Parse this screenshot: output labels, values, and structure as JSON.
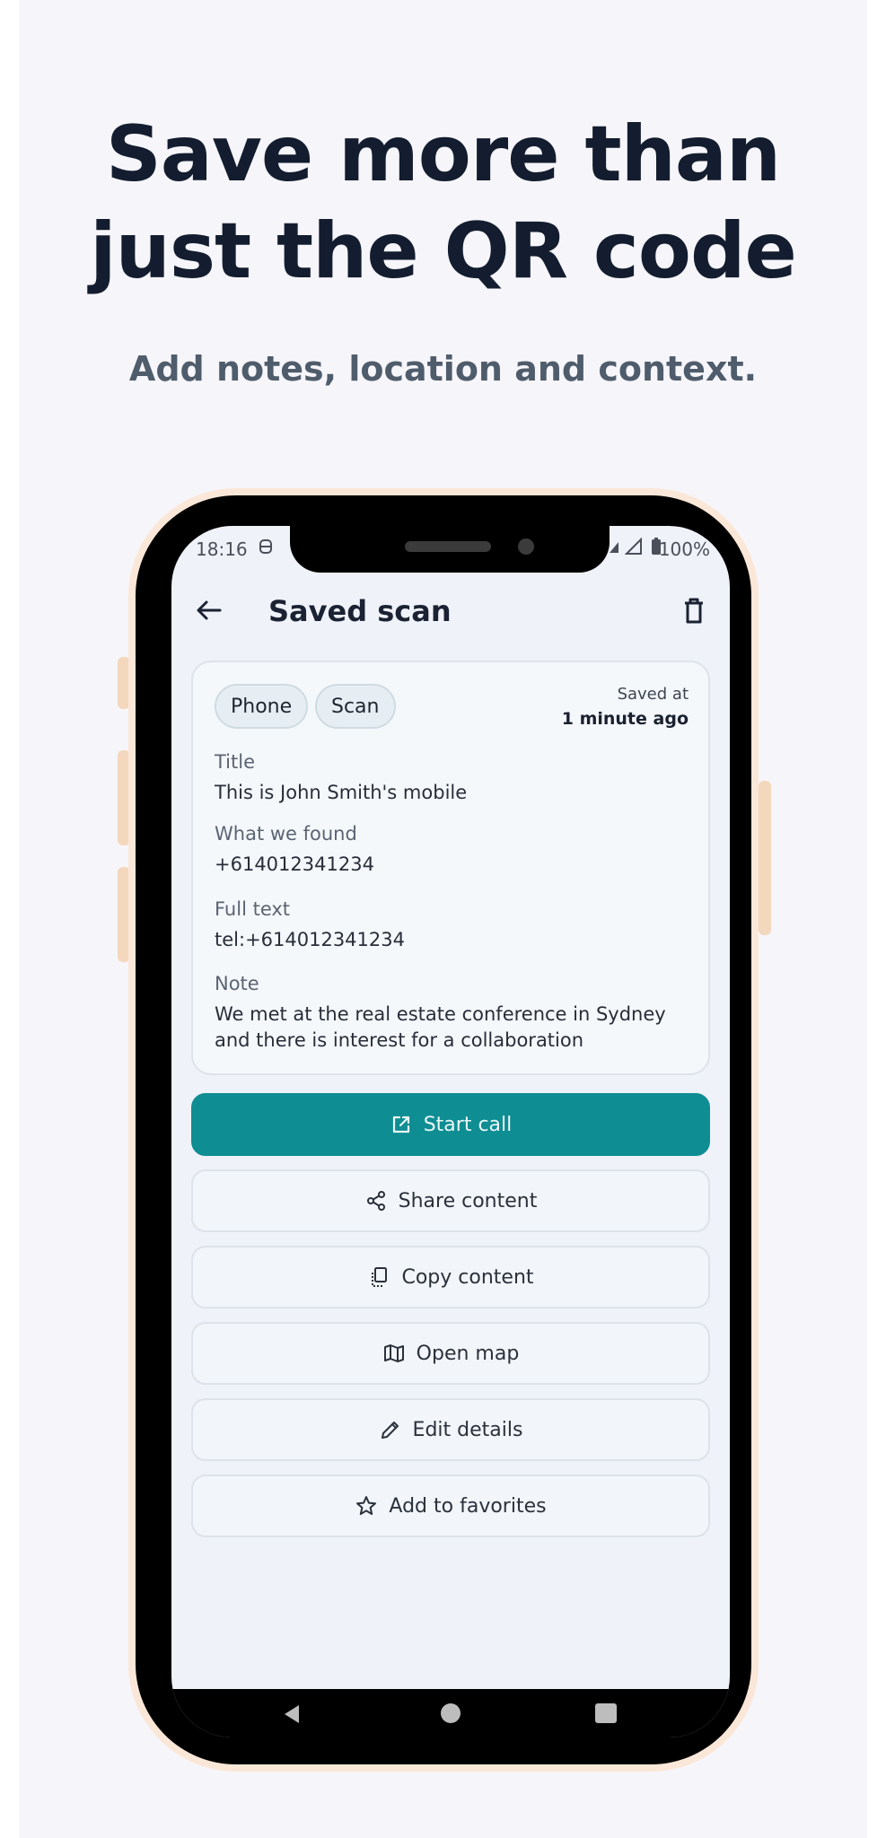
{
  "headline": {
    "line1": "Save more than",
    "line2": "just the QR code",
    "subtitle": "Add notes, location and context."
  },
  "status_bar": {
    "time": "18:16",
    "battery": "100%"
  },
  "app_bar": {
    "title": "Saved scan",
    "back_icon": "arrow-left-icon",
    "delete_icon": "trash-icon"
  },
  "card": {
    "chips": [
      "Phone",
      "Scan"
    ],
    "saved_at_label": "Saved at",
    "saved_at_value": "1 minute ago",
    "fields": [
      {
        "label": "Title",
        "value": "This is John Smith's mobile"
      },
      {
        "label": "What we found",
        "value": "+614012341234"
      },
      {
        "label": "Full text",
        "value": "tel:+614012341234"
      },
      {
        "label": "Note",
        "value": "We met at the real estate conference in Sydney and there is interest for a collaboration"
      }
    ]
  },
  "actions": [
    {
      "label": "Start call",
      "icon": "external-link-icon",
      "primary": true
    },
    {
      "label": "Share content",
      "icon": "share-icon"
    },
    {
      "label": "Copy content",
      "icon": "copy-icon"
    },
    {
      "label": "Open map",
      "icon": "map-icon"
    },
    {
      "label": "Edit details",
      "icon": "pencil-icon"
    },
    {
      "label": "Add to favorites",
      "icon": "star-icon"
    }
  ],
  "colors": {
    "primary": "#0e8d93",
    "headline": "#131d2f",
    "subtitle": "#4f5c6b",
    "phone_frame": "#fbe7d8"
  }
}
